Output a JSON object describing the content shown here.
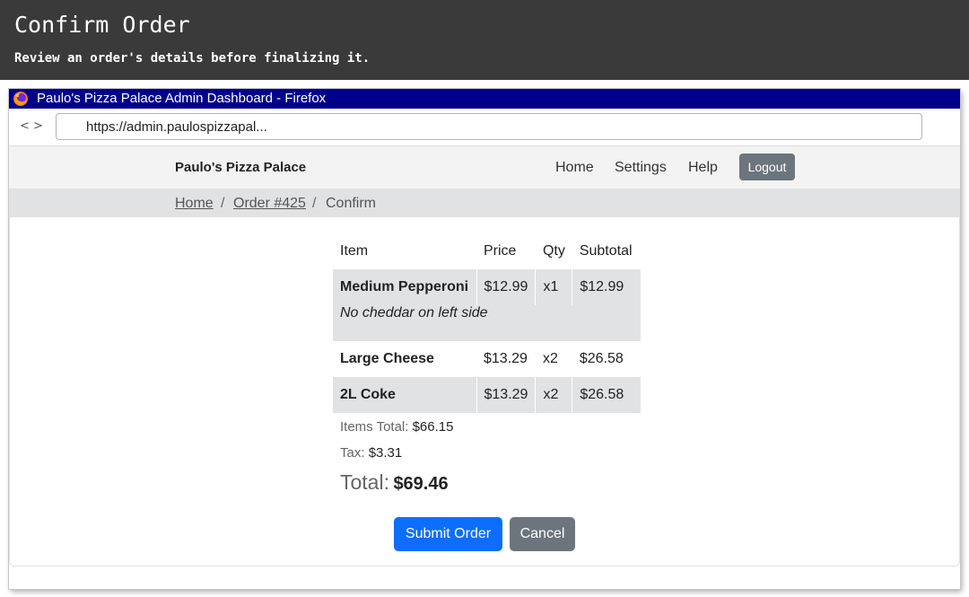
{
  "banner": {
    "title": "Confirm Order",
    "subtitle": "Review an order's details before finalizing it."
  },
  "browser": {
    "title": "Paulo's Pizza Palace Admin Dashboard - Firefox",
    "back_label": "<",
    "forward_label": ">",
    "url": "https://admin.paulospizzapal..."
  },
  "site": {
    "brand": "Paulo's Pizza Palace",
    "nav": [
      "Home",
      "Settings",
      "Help"
    ],
    "logout_label": "Logout"
  },
  "breadcrumb": {
    "items": [
      "Home",
      "Order #425",
      "Confirm"
    ],
    "separator": "/"
  },
  "order": {
    "headers": [
      "Item",
      "Price",
      "Qty",
      "Subtotal"
    ],
    "rows": [
      {
        "name": "Medium Pepperoni",
        "price": "$12.99",
        "qty": "x1",
        "subtotal": "$12.99",
        "note": "No cheddar on left side"
      },
      {
        "name": "Large Cheese",
        "price": "$13.29",
        "qty": "x2",
        "subtotal": "$26.58"
      },
      {
        "name": "2L Coke",
        "price": "$13.29",
        "qty": "x2",
        "subtotal": "$26.58"
      }
    ],
    "items_total_label": "Items Total:",
    "items_total_value": "$66.15",
    "tax_label": "Tax:",
    "tax_value": "$3.31",
    "total_label": "Total:",
    "total_value": "$69.46"
  },
  "actions": {
    "submit_label": "Submit Order",
    "cancel_label": "Cancel"
  },
  "colors": {
    "banner_bg": "#3a3a3a",
    "titlebar_bg": "#00008b",
    "primary": "#0d6efd",
    "secondary": "#6c757d",
    "shaded_row": "#e1e2e4"
  }
}
